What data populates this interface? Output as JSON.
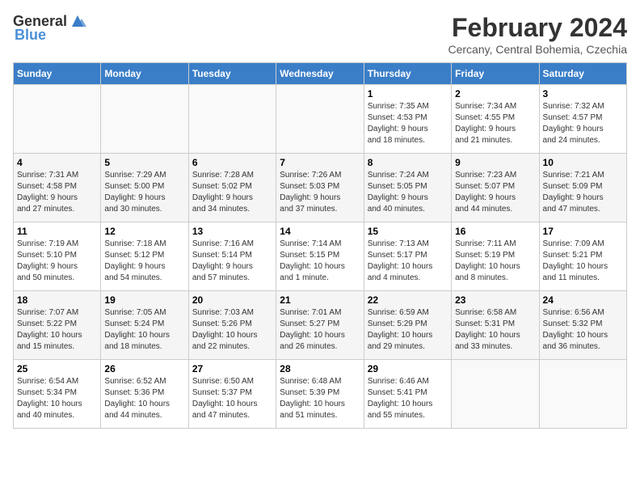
{
  "header": {
    "logo_general": "General",
    "logo_blue": "Blue",
    "month_year": "February 2024",
    "location": "Cercany, Central Bohemia, Czechia"
  },
  "weekdays": [
    "Sunday",
    "Monday",
    "Tuesday",
    "Wednesday",
    "Thursday",
    "Friday",
    "Saturday"
  ],
  "weeks": [
    [
      {
        "day": "",
        "info": ""
      },
      {
        "day": "",
        "info": ""
      },
      {
        "day": "",
        "info": ""
      },
      {
        "day": "",
        "info": ""
      },
      {
        "day": "1",
        "info": "Sunrise: 7:35 AM\nSunset: 4:53 PM\nDaylight: 9 hours\nand 18 minutes."
      },
      {
        "day": "2",
        "info": "Sunrise: 7:34 AM\nSunset: 4:55 PM\nDaylight: 9 hours\nand 21 minutes."
      },
      {
        "day": "3",
        "info": "Sunrise: 7:32 AM\nSunset: 4:57 PM\nDaylight: 9 hours\nand 24 minutes."
      }
    ],
    [
      {
        "day": "4",
        "info": "Sunrise: 7:31 AM\nSunset: 4:58 PM\nDaylight: 9 hours\nand 27 minutes."
      },
      {
        "day": "5",
        "info": "Sunrise: 7:29 AM\nSunset: 5:00 PM\nDaylight: 9 hours\nand 30 minutes."
      },
      {
        "day": "6",
        "info": "Sunrise: 7:28 AM\nSunset: 5:02 PM\nDaylight: 9 hours\nand 34 minutes."
      },
      {
        "day": "7",
        "info": "Sunrise: 7:26 AM\nSunset: 5:03 PM\nDaylight: 9 hours\nand 37 minutes."
      },
      {
        "day": "8",
        "info": "Sunrise: 7:24 AM\nSunset: 5:05 PM\nDaylight: 9 hours\nand 40 minutes."
      },
      {
        "day": "9",
        "info": "Sunrise: 7:23 AM\nSunset: 5:07 PM\nDaylight: 9 hours\nand 44 minutes."
      },
      {
        "day": "10",
        "info": "Sunrise: 7:21 AM\nSunset: 5:09 PM\nDaylight: 9 hours\nand 47 minutes."
      }
    ],
    [
      {
        "day": "11",
        "info": "Sunrise: 7:19 AM\nSunset: 5:10 PM\nDaylight: 9 hours\nand 50 minutes."
      },
      {
        "day": "12",
        "info": "Sunrise: 7:18 AM\nSunset: 5:12 PM\nDaylight: 9 hours\nand 54 minutes."
      },
      {
        "day": "13",
        "info": "Sunrise: 7:16 AM\nSunset: 5:14 PM\nDaylight: 9 hours\nand 57 minutes."
      },
      {
        "day": "14",
        "info": "Sunrise: 7:14 AM\nSunset: 5:15 PM\nDaylight: 10 hours\nand 1 minute."
      },
      {
        "day": "15",
        "info": "Sunrise: 7:13 AM\nSunset: 5:17 PM\nDaylight: 10 hours\nand 4 minutes."
      },
      {
        "day": "16",
        "info": "Sunrise: 7:11 AM\nSunset: 5:19 PM\nDaylight: 10 hours\nand 8 minutes."
      },
      {
        "day": "17",
        "info": "Sunrise: 7:09 AM\nSunset: 5:21 PM\nDaylight: 10 hours\nand 11 minutes."
      }
    ],
    [
      {
        "day": "18",
        "info": "Sunrise: 7:07 AM\nSunset: 5:22 PM\nDaylight: 10 hours\nand 15 minutes."
      },
      {
        "day": "19",
        "info": "Sunrise: 7:05 AM\nSunset: 5:24 PM\nDaylight: 10 hours\nand 18 minutes."
      },
      {
        "day": "20",
        "info": "Sunrise: 7:03 AM\nSunset: 5:26 PM\nDaylight: 10 hours\nand 22 minutes."
      },
      {
        "day": "21",
        "info": "Sunrise: 7:01 AM\nSunset: 5:27 PM\nDaylight: 10 hours\nand 26 minutes."
      },
      {
        "day": "22",
        "info": "Sunrise: 6:59 AM\nSunset: 5:29 PM\nDaylight: 10 hours\nand 29 minutes."
      },
      {
        "day": "23",
        "info": "Sunrise: 6:58 AM\nSunset: 5:31 PM\nDaylight: 10 hours\nand 33 minutes."
      },
      {
        "day": "24",
        "info": "Sunrise: 6:56 AM\nSunset: 5:32 PM\nDaylight: 10 hours\nand 36 minutes."
      }
    ],
    [
      {
        "day": "25",
        "info": "Sunrise: 6:54 AM\nSunset: 5:34 PM\nDaylight: 10 hours\nand 40 minutes."
      },
      {
        "day": "26",
        "info": "Sunrise: 6:52 AM\nSunset: 5:36 PM\nDaylight: 10 hours\nand 44 minutes."
      },
      {
        "day": "27",
        "info": "Sunrise: 6:50 AM\nSunset: 5:37 PM\nDaylight: 10 hours\nand 47 minutes."
      },
      {
        "day": "28",
        "info": "Sunrise: 6:48 AM\nSunset: 5:39 PM\nDaylight: 10 hours\nand 51 minutes."
      },
      {
        "day": "29",
        "info": "Sunrise: 6:46 AM\nSunset: 5:41 PM\nDaylight: 10 hours\nand 55 minutes."
      },
      {
        "day": "",
        "info": ""
      },
      {
        "day": "",
        "info": ""
      }
    ]
  ]
}
